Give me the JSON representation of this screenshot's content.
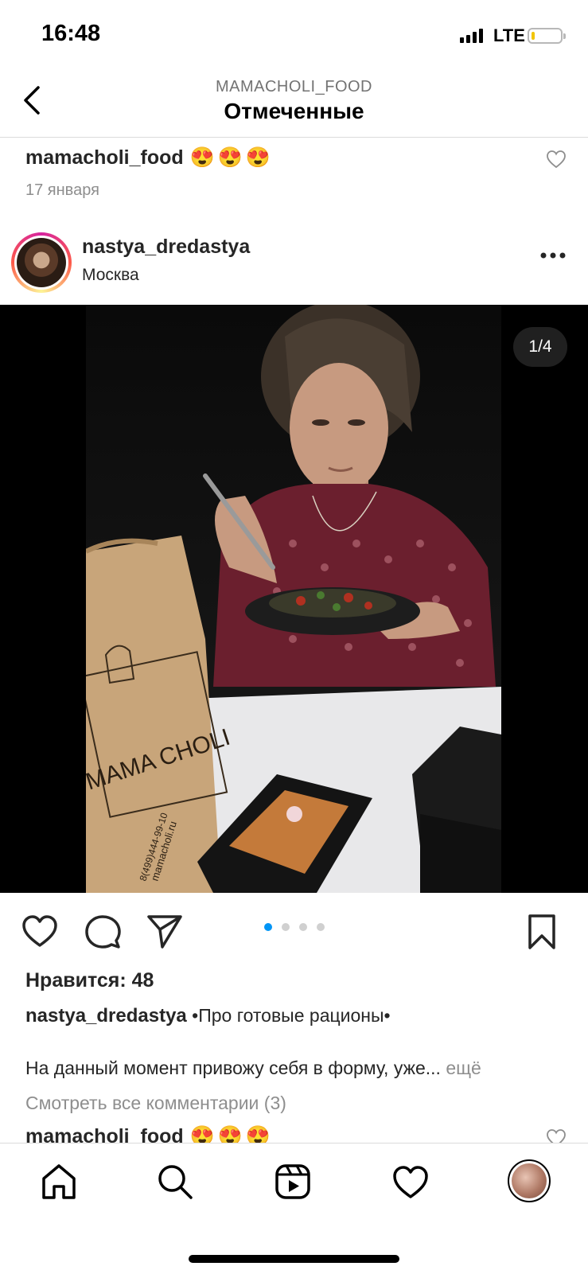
{
  "status_bar": {
    "time": "16:48",
    "network": "LTE"
  },
  "header": {
    "subtitle": "MAMACHOLI_FOOD",
    "title": "Отмеченные"
  },
  "previous_comment": {
    "username": "mamacholi_food",
    "emoji": "😍😍😍",
    "date": "17 января"
  },
  "post": {
    "username": "nastya_dredastya",
    "location": "Москва",
    "image_counter": "1/4",
    "carousel": {
      "count": 4,
      "active_index": 0
    },
    "photo": {
      "bag_brand": "MAMA CHOLI",
      "bag_phone": "8(499)444-99-10",
      "bag_site": "mamacholi.ru"
    },
    "likes": "Нравится: 48",
    "caption_username": "nastya_dredastya",
    "caption_tag": "•Про готовые рационы•",
    "caption_text": "На данный момент привожу себя в форму, уже...",
    "caption_more": "ещё",
    "view_comments": "Смотреть все комментарии (3)",
    "comment": {
      "username": "mamacholi_food",
      "emoji": "😍😍😍"
    }
  },
  "tab_bar": {
    "items": [
      "home-icon",
      "search-icon",
      "reels-icon",
      "heart-icon",
      "profile-avatar"
    ]
  },
  "colors": {
    "accent": "#0095f6",
    "text": "#262626",
    "muted": "#8e8e8e"
  }
}
